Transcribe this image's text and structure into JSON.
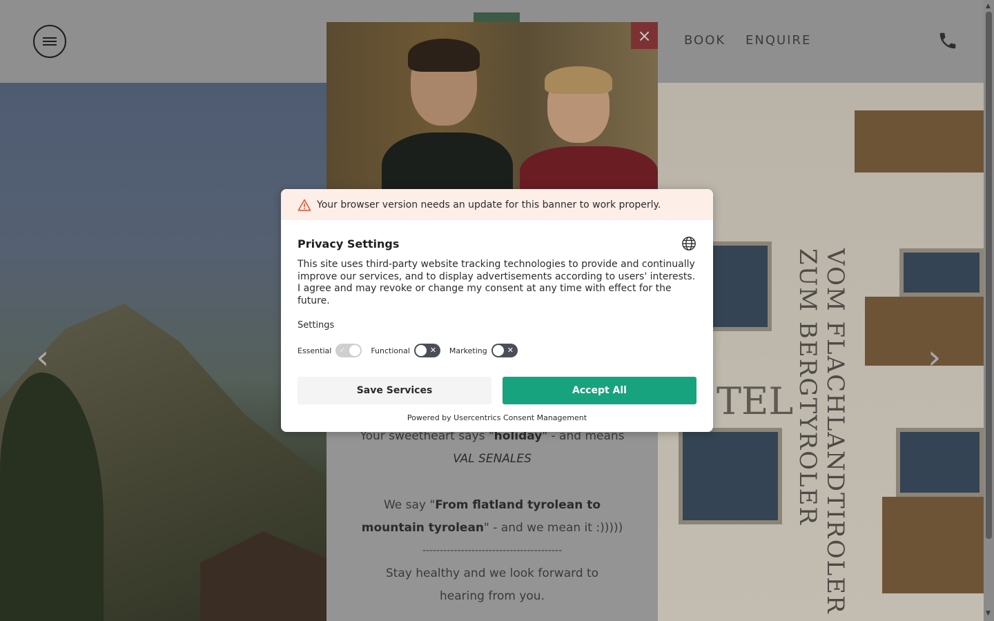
{
  "header": {
    "nav": {
      "book": "BOOK",
      "enquire": "ENQUIRE"
    },
    "icons": {
      "menu": "hamburger-menu-icon",
      "phone": "phone-icon"
    }
  },
  "hero": {
    "vertical_text": "VOM FLACHLANDTIROLER ZUM BERGTYROLER",
    "hotel_word": "TEL",
    "arrows": {
      "prev": "‹",
      "next": "›"
    }
  },
  "promo": {
    "close_symbol": "×",
    "line1_pre": "Your sweetheart says \"",
    "line1_bold": "holiday",
    "line1_post": "\" - and means",
    "line2_italic": "VAL SENALES",
    "line3_pre": "We say \"",
    "line3_bold": "From flatland tyrolean to mountain tyrolean",
    "line3_post": "\" - and we mean it :)))))",
    "divider": "----------------------------------------",
    "line4": "Stay healthy and we look forward to hearing from you."
  },
  "consent": {
    "warning": "Your browser version needs an update for this banner to work properly.",
    "title": "Privacy Settings",
    "description": "This site uses third-party website tracking technologies to provide and continually improve our services, and to display advertisements according to users' interests. I agree and may revoke or change my consent at any time with effect for the future.",
    "settings_label": "Settings",
    "toggles": [
      {
        "label": "Essential",
        "state": "on",
        "disabled": true,
        "mark": "✓"
      },
      {
        "label": "Functional",
        "state": "off",
        "disabled": false,
        "mark": "✕"
      },
      {
        "label": "Marketing",
        "state": "off",
        "disabled": false,
        "mark": "✕"
      }
    ],
    "save_label": "Save Services",
    "accept_label": "Accept All",
    "powered_by": "Powered by Usercentrics Consent Management",
    "colors": {
      "accept": "#17a37d",
      "warning_bg": "#fdeee7",
      "warning_icon": "#e2573b"
    }
  }
}
